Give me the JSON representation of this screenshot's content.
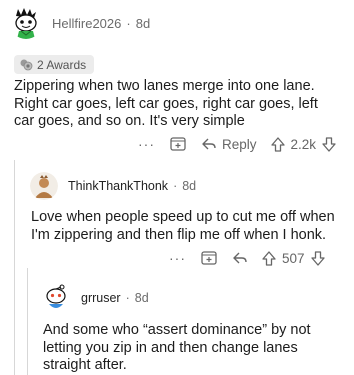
{
  "comments": [
    {
      "username": "Hellfire2026",
      "age": "8d",
      "awards": "2 Awards",
      "body": "Zippering when two lanes merge into one lane.\nRight car goes, left car goes, right car goes, left\ncar goes, and so on. It's very simple",
      "more": "···",
      "reply_label": "Reply",
      "score": "2.2k"
    },
    {
      "username": "ThinkThankThonk",
      "age": "8d",
      "body": "Love when people speed up to cut me off when\nI'm zippering and then flip me off when I honk.",
      "more": "···",
      "score": "507"
    },
    {
      "username": "grruser",
      "age": "8d",
      "body": "And some who “assert dominance” by not\nletting you zip in and then change lanes\nstraight after."
    }
  ],
  "separator": "·",
  "colors": {
    "text": "#1c1c1c",
    "meta": "#6b6b6b",
    "thread_line": "#d7d7d7",
    "award_bg": "#ececec"
  },
  "icons": [
    "avatar-snoo-icon",
    "award-icon",
    "more-icon",
    "gif-add-icon",
    "reply-arrow-icon",
    "upvote-icon",
    "downvote-icon"
  ]
}
